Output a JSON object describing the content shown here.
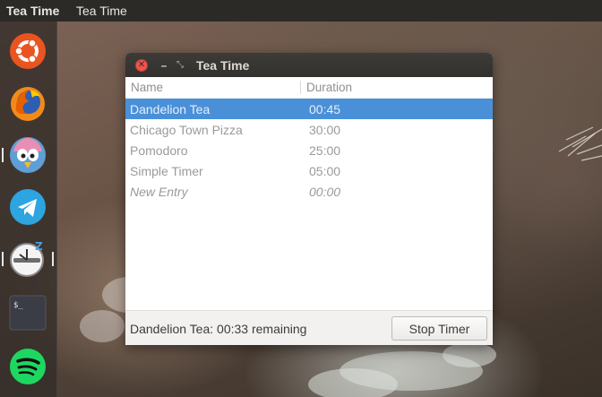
{
  "top_panel": {
    "app_name": "Tea Time",
    "menu_item": "Tea Time"
  },
  "launcher": {
    "items": [
      {
        "name": "ubuntu",
        "active": false
      },
      {
        "name": "firefox",
        "active": false
      },
      {
        "name": "bird-chat",
        "active": true
      },
      {
        "name": "telegram",
        "active": false
      },
      {
        "name": "tea-time",
        "active": true
      },
      {
        "name": "terminal",
        "active": false,
        "label": "$_"
      },
      {
        "name": "spotify",
        "active": false
      }
    ]
  },
  "window": {
    "title": "Tea Time",
    "close_glyph": "✕",
    "minimize_glyph": "–",
    "maximize_glyph": "⤡",
    "columns": {
      "name": "Name",
      "duration": "Duration"
    },
    "rows": [
      {
        "name": "Dandelion Tea",
        "duration": "00:45"
      },
      {
        "name": "Chicago Town Pizza",
        "duration": "30:00"
      },
      {
        "name": "Pomodoro",
        "duration": "25:00"
      },
      {
        "name": "Simple Timer",
        "duration": "05:00"
      },
      {
        "name": "New Entry",
        "duration": "00:00"
      }
    ],
    "status": "Dandelion Tea: 00:33 remaining",
    "stop_button": "Stop Timer"
  },
  "colors": {
    "selection": "#4a90d9",
    "panel": "#2b2a27",
    "close_button": "#f0544c"
  }
}
